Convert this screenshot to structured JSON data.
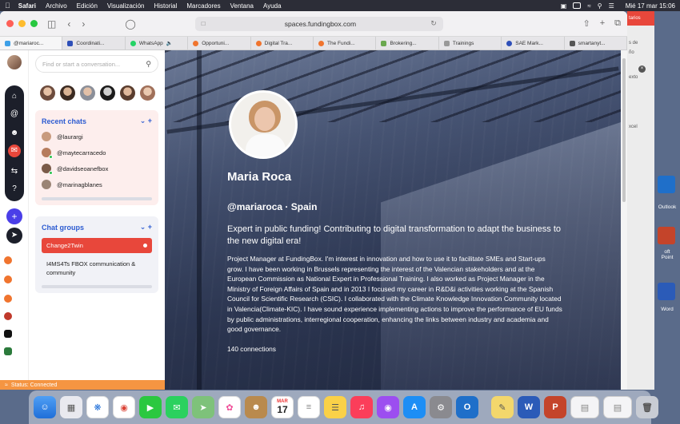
{
  "menubar": {
    "app": "Safari",
    "items": [
      "Archivo",
      "Edición",
      "Visualización",
      "Historial",
      "Marcadores",
      "Ventana",
      "Ayuda"
    ],
    "clock": "Mié 17 mar  15:06"
  },
  "browser": {
    "url": "spaces.fundingbox.com",
    "tabs": [
      {
        "label": "@mariaroc...",
        "color": "#3ea0e8"
      },
      {
        "label": "Coordinati...",
        "color": "#2e4fb8"
      },
      {
        "label": "WhatsApp",
        "color": "#25d366"
      },
      {
        "label": "Opportuni...",
        "color": "#f0742e"
      },
      {
        "label": "Digital Tra...",
        "color": "#f0742e"
      },
      {
        "label": "The Fundi...",
        "color": "#f0742e"
      },
      {
        "label": "Brokering...",
        "color": "#6aa84f"
      },
      {
        "label": "Trainings",
        "color": "#999999"
      },
      {
        "label": "SAE Mark...",
        "color": "#2e4fb8"
      },
      {
        "label": "smartanyt...",
        "color": "#555555"
      }
    ]
  },
  "sidebar": {
    "search_placeholder": "Find or start a conversation...",
    "recent_title": "Recent chats",
    "recent_actions": "⌄ +",
    "recent_chats": [
      "@laurargi",
      "@maytecarracedo",
      "@davidseoanefbox",
      "@marinagblanes"
    ],
    "groups_title": "Chat groups",
    "groups_actions": "⌄ +",
    "active_group": "Change2Twin",
    "groups": [
      "I4MS4Ts FBOX communication & community"
    ],
    "status": "Status: Connected"
  },
  "profile": {
    "name": "Maria Roca",
    "handle": "@mariaroca · Spain",
    "tagline": "Expert in public funding! Contributing to digital transformation to adapt the business to the new digital era!",
    "bio": "Project Manager at FundingBox. I'm interest in innovation and how to use it to facilitate SMEs and Start-ups grow. I have been working in Brussels representing the interest of the Valencian stakeholders and at the European Commission as National Expert in Professional Training. I also worked as Project Manager in the Ministry of Foreign Affairs of Spain and in 2013 I focused my career in R&D&i activities working at the Spanish Council for Scientific Research (CSIC). I collaborated with the Climate Knowledge Innovation Community located in Valencia(Climate-KIC). I have sound experience implementing actions to improve the performance of EU funds by public administrations, interregional cooperation, enhancing the links between industry and academia and good governance.",
    "connections": "140 connections"
  },
  "background_window": {
    "header": "tarios",
    "lines": [
      "s de",
      "ño",
      "exto",
      "xcel"
    ]
  },
  "desktop": {
    "labels": [
      "Outlook",
      "oft\nPoint",
      "Word"
    ]
  },
  "dock": {
    "calendar_month": "MAR",
    "calendar_day": "17"
  }
}
